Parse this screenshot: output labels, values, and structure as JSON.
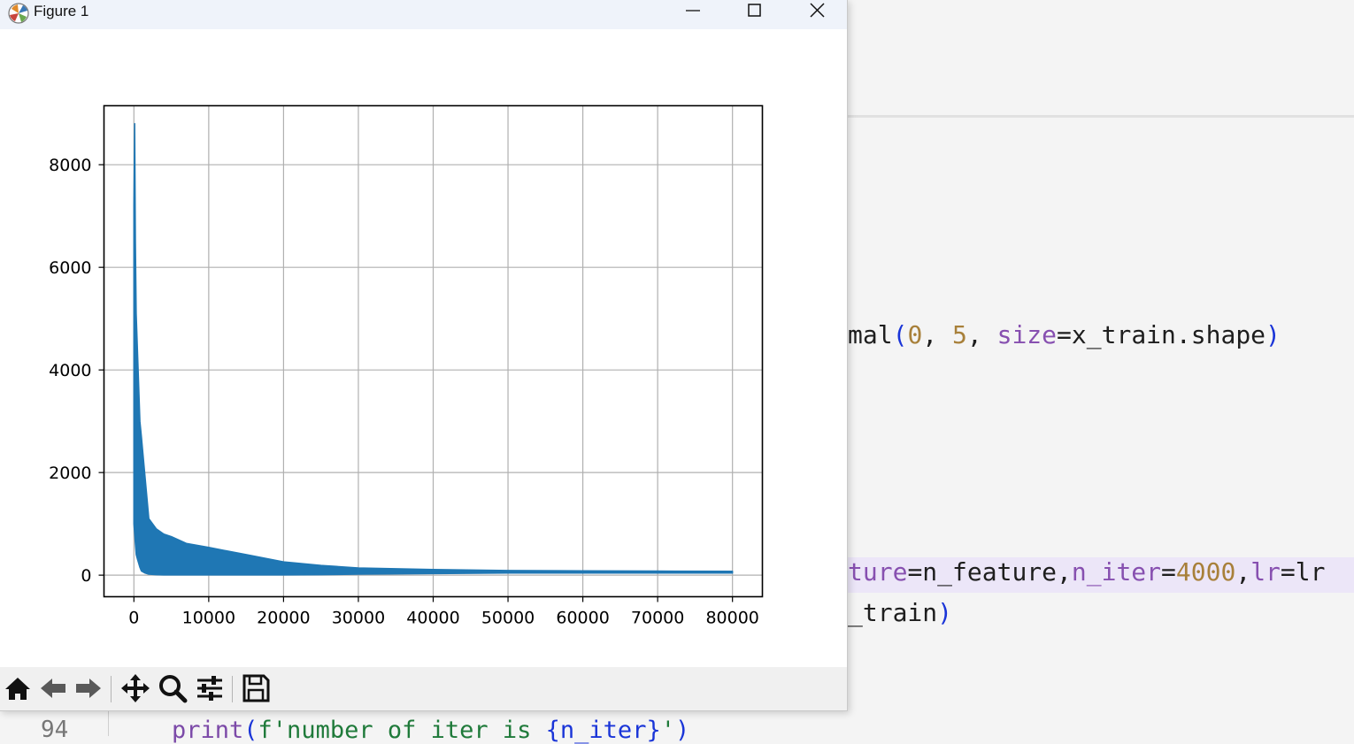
{
  "window": {
    "title": "Figure 1",
    "controls": [
      "minimize",
      "maximize",
      "close"
    ]
  },
  "toolbar": {
    "buttons": [
      {
        "name": "home",
        "icon": "home-icon"
      },
      {
        "name": "back",
        "icon": "arrow-left-icon"
      },
      {
        "name": "forward",
        "icon": "arrow-right-icon"
      },
      {
        "name": "pan",
        "icon": "move-arrows-icon"
      },
      {
        "name": "zoom",
        "icon": "magnifier-icon"
      },
      {
        "name": "configure-subplots",
        "icon": "sliders-icon"
      },
      {
        "name": "save",
        "icon": "floppy-disk-icon"
      }
    ]
  },
  "chart_data": {
    "type": "line",
    "title": "",
    "xlabel": "",
    "ylabel": "",
    "xlim": [
      -4000,
      84000
    ],
    "ylim": [
      -420,
      9150
    ],
    "xticks": [
      0,
      10000,
      20000,
      30000,
      40000,
      50000,
      60000,
      70000,
      80000
    ],
    "xtick_labels": [
      "0",
      "10000",
      "20000",
      "30000",
      "40000",
      "50000",
      "60000",
      "70000",
      "80000"
    ],
    "yticks": [
      0,
      2000,
      4000,
      6000,
      8000
    ],
    "ytick_labels": [
      "0",
      "2000",
      "4000",
      "6000",
      "8000"
    ],
    "grid": true,
    "color": "#1f77b4",
    "series": [
      {
        "x": [
          0,
          100,
          200,
          300,
          500,
          800,
          1000,
          1500,
          2000,
          3000,
          4000,
          5000,
          7000,
          10000,
          15000,
          20000,
          25000,
          30000,
          40000,
          50000,
          60000,
          70000,
          80000
        ],
        "upper": [
          7200,
          8800,
          6500,
          5100,
          4300,
          3000,
          2700,
          1900,
          1100,
          900,
          800,
          750,
          620,
          540,
          400,
          260,
          190,
          140,
          110,
          90,
          85,
          80,
          75
        ],
        "lower": [
          1000,
          800,
          600,
          400,
          300,
          150,
          80,
          40,
          20,
          10,
          5,
          5,
          5,
          5,
          5,
          5,
          10,
          20,
          30,
          40,
          40,
          40,
          40
        ]
      }
    ]
  },
  "editor": {
    "line1": {
      "a": "mal",
      "b": "(",
      "c": "0",
      "d": ", ",
      "e": "5",
      "f": ", ",
      "g": "size",
      "h": "=x_train.shape",
      "i": ")"
    },
    "line2": {
      "a": "ture",
      "b": "=n_feature,",
      "c": "n_iter",
      "d": "=",
      "e": "4000",
      "f": ",",
      "g": "lr",
      "h": "=lr"
    },
    "line3": {
      "a": "_train",
      "b": ")"
    },
    "line4": {
      "num": "94",
      "a": "print",
      "b": "(",
      "c": "f'number of iter is ",
      "d": "{n_iter}",
      "e": "'",
      "f": ")"
    }
  }
}
